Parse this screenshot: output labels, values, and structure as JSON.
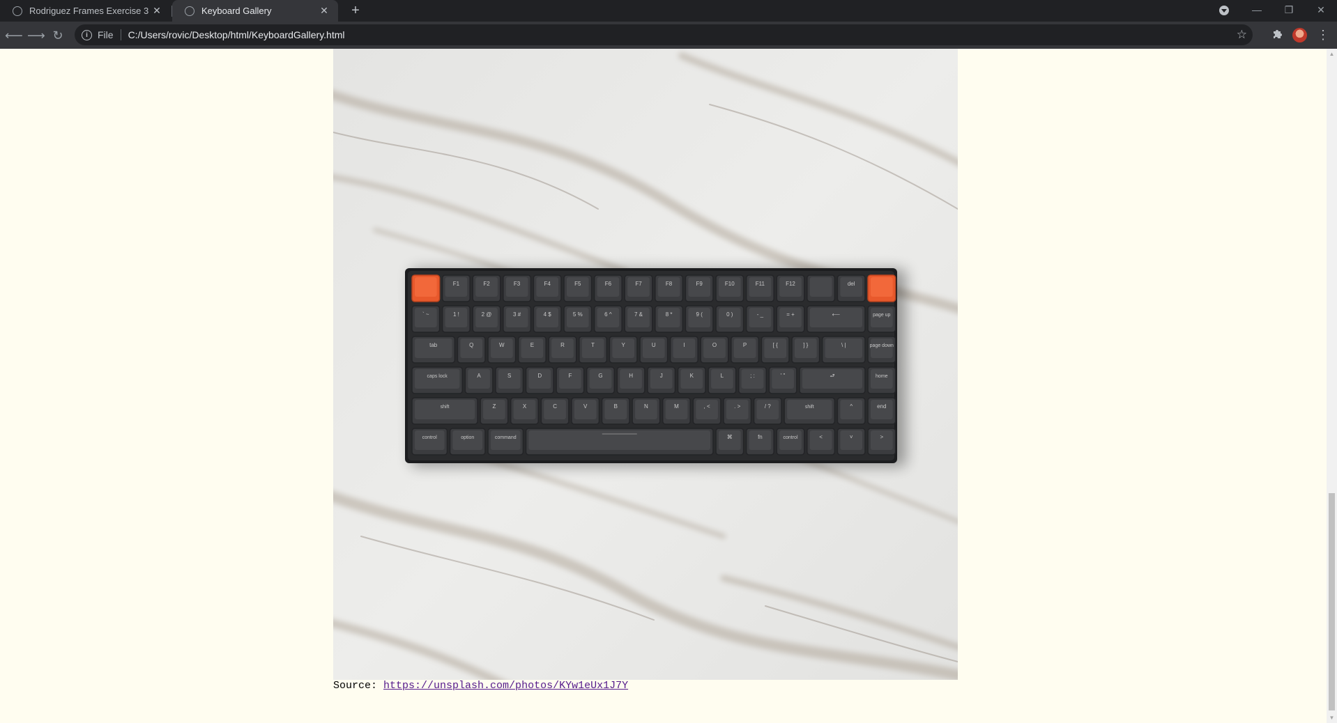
{
  "tabs": [
    {
      "title": "Rodriguez Frames Exercise 3",
      "active": false
    },
    {
      "title": "Keyboard Gallery",
      "active": true
    }
  ],
  "toolbar": {
    "scheme": "File",
    "url": "C:/Users/rovic/Desktop/html/KeyboardGallery.html"
  },
  "page": {
    "image_icon": "keyboard-photo",
    "source_label": "Source:",
    "source_link": "https://unsplash.com/photos/KYw1eUx1J7Y"
  },
  "keyboard": {
    "rows": [
      [
        "",
        "F1",
        "F2",
        "F3",
        "F4",
        "F5",
        "F6",
        "F7",
        "F8",
        "F9",
        "F10",
        "F11",
        "F12",
        "",
        "del",
        ""
      ],
      [
        "` ~",
        "1 !",
        "2 @",
        "3 #",
        "4 $",
        "5 %",
        "6 ^",
        "7 &",
        "8 *",
        "9 (",
        "0 )",
        "- _",
        "= +",
        "⟵",
        "page up"
      ],
      [
        "tab",
        "Q",
        "W",
        "E",
        "R",
        "T",
        "Y",
        "U",
        "I",
        "O",
        "P",
        "[ {",
        "] }",
        "\\ |",
        "page down"
      ],
      [
        "caps lock",
        "A",
        "S",
        "D",
        "F",
        "G",
        "H",
        "J",
        "K",
        "L",
        "; :",
        "' \"",
        "⮐",
        "home"
      ],
      [
        "shift",
        "Z",
        "X",
        "C",
        "V",
        "B",
        "N",
        "M",
        ", <",
        ". >",
        "/ ?",
        "shift",
        "^",
        "end"
      ],
      [
        "control",
        "option",
        "command",
        "",
        "⌘",
        "fn",
        "control",
        "<",
        "˅",
        ">"
      ]
    ]
  },
  "colors": {
    "page_bg": "#fffdf0",
    "link": "#551a8b",
    "accent_key": "#e8592c"
  }
}
